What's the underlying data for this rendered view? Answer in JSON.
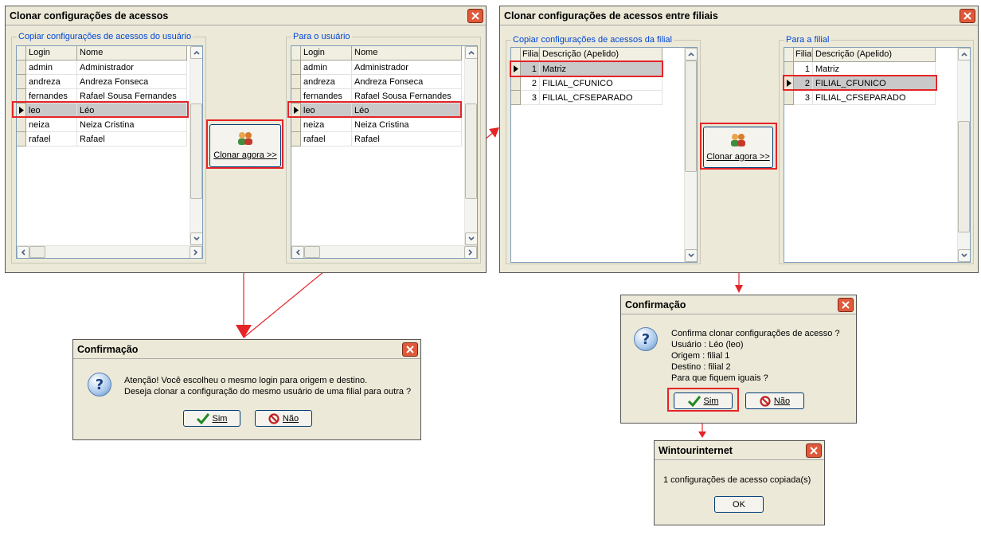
{
  "win1": {
    "title": "Clonar configurações de acessos",
    "src_legend": "Copiar configurações de acessos do usuário",
    "dst_legend": "Para o usuário",
    "columns": [
      "Login",
      "Nome"
    ],
    "rows": [
      {
        "login": "admin",
        "nome": "Administrador"
      },
      {
        "login": "andreza",
        "nome": "Andreza Fonseca"
      },
      {
        "login": "fernandes",
        "nome": "Rafael Sousa Fernandes"
      },
      {
        "login": "leo",
        "nome": "Léo"
      },
      {
        "login": "neiza",
        "nome": "Neiza Cristina"
      },
      {
        "login": "rafael",
        "nome": "Rafael"
      }
    ],
    "selected_row": "leo",
    "clone_button": "Clonar agora >>"
  },
  "win2": {
    "title": "Clonar configurações de acessos entre filiais",
    "src_legend": "Copiar configurações de acessos da filial",
    "dst_legend": "Para a filial",
    "columns": [
      "Filial",
      "Descrição (Apelido)"
    ],
    "rows": [
      {
        "filial": "1",
        "desc": "Matriz"
      },
      {
        "filial": "2",
        "desc": "FILIAL_CFUNICO"
      },
      {
        "filial": "3",
        "desc": "FILIAL_CFSEPARADO"
      }
    ],
    "src_selected": "1",
    "dst_selected": "2",
    "clone_button": "Clonar agora >>"
  },
  "dialog1": {
    "title": "Confirmação",
    "line1": "Atenção! Você escolheu o mesmo login para origem e destino.",
    "line2": "Deseja clonar a configuração do mesmo usuário de uma filial para outra ?",
    "yes": "Sim",
    "no": "Não"
  },
  "dialog2": {
    "title": "Confirmação",
    "line1": "Confirma clonar configurações de acesso ?",
    "line2": "Usuário : Léo (leo)",
    "line3": "Origem : filial 1",
    "line4": "Destino : filial 2",
    "line5": "Para que fiquem iguais ?",
    "yes": "Sim",
    "no": "Não"
  },
  "dialog3": {
    "title": "Wintourinternet",
    "message": "1 configurações de acesso copiada(s)",
    "ok": "OK"
  },
  "colors": {
    "highlight": "#e52427",
    "legend": "#0046d5",
    "window_bg": "#ece9d8"
  }
}
